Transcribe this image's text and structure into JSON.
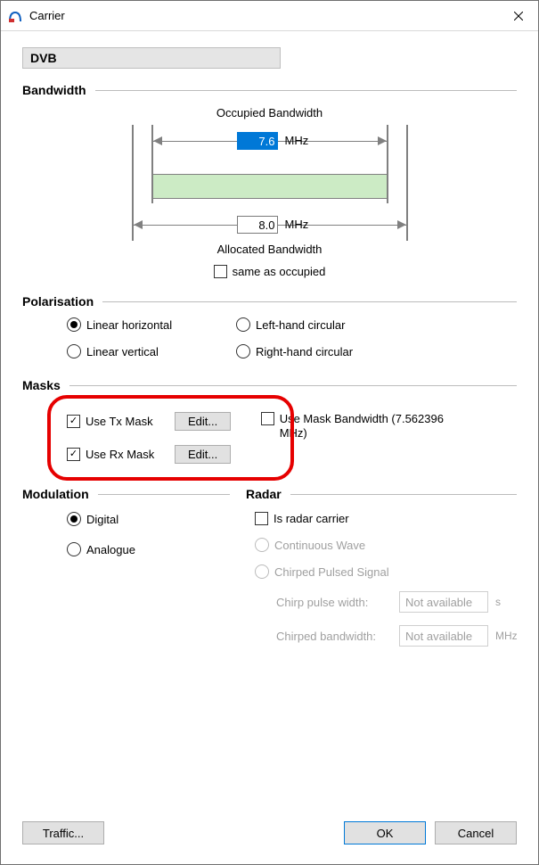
{
  "window": {
    "title": "Carrier",
    "close_icon": "✕"
  },
  "carrier_name": "DVB",
  "bandwidth": {
    "group_label": "Bandwidth",
    "occupied_caption": "Occupied Bandwidth",
    "occupied_value": "7.6",
    "occupied_unit": "MHz",
    "allocated_value": "8.0",
    "allocated_unit": "MHz",
    "allocated_caption": "Allocated Bandwidth",
    "same_label": "same as occupied",
    "same_checked": false
  },
  "polarisation": {
    "group_label": "Polarisation",
    "options": {
      "lh": "Linear horizontal",
      "lv": "Linear vertical",
      "lc": "Left-hand circular",
      "rc": "Right-hand circular"
    },
    "selected": "lh"
  },
  "masks": {
    "group_label": "Masks",
    "use_tx_label": "Use Tx Mask",
    "use_tx_checked": true,
    "use_rx_label": "Use Rx Mask",
    "use_rx_checked": true,
    "edit_label": "Edit...",
    "use_bw_label": "Use Mask Bandwidth (7.562396 MHz)",
    "use_bw_checked": false
  },
  "modulation": {
    "group_label": "Modulation",
    "digital": "Digital",
    "analogue": "Analogue",
    "selected": "digital"
  },
  "radar": {
    "group_label": "Radar",
    "is_radar_label": "Is radar carrier",
    "is_radar_checked": false,
    "cw_label": "Continuous Wave",
    "cps_label": "Chirped Pulsed Signal",
    "chirp_width_label": "Chirp pulse width:",
    "chirp_bw_label": "Chirped bandwidth:",
    "not_available": "Not available",
    "unit_s": "s",
    "unit_mhz": "MHz"
  },
  "footer": {
    "traffic": "Traffic...",
    "ok": "OK",
    "cancel": "Cancel"
  }
}
